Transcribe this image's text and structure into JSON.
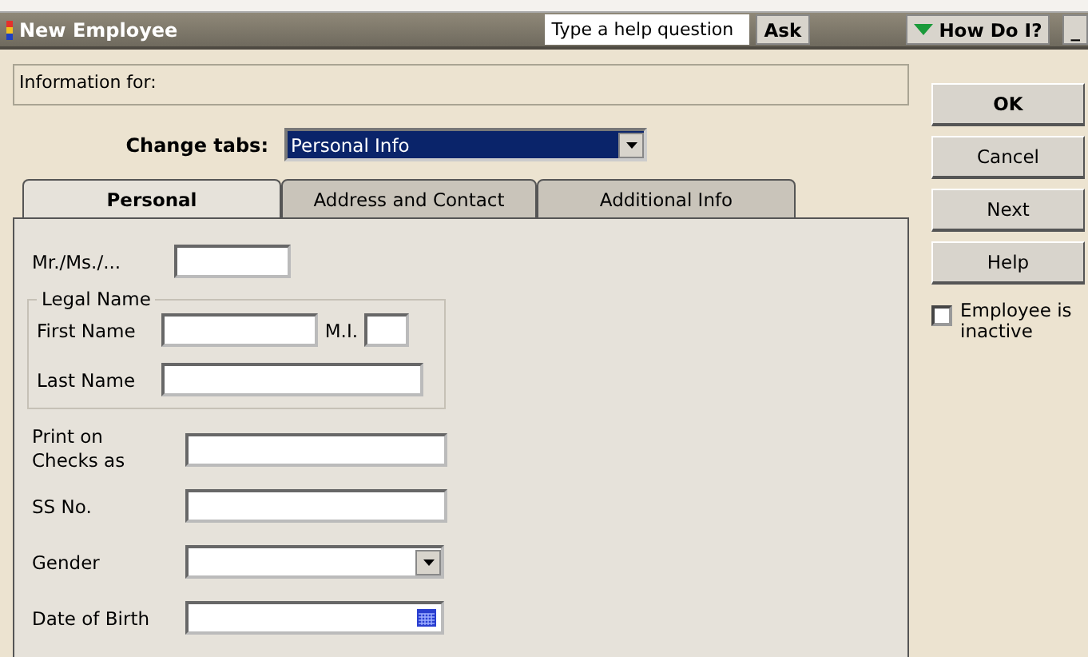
{
  "window": {
    "title": "New Employee"
  },
  "help": {
    "placeholder": "Type a help question",
    "ask": "Ask",
    "how_do_i": "How Do I?",
    "minimize": "_"
  },
  "info_for": {
    "label": "Information for:"
  },
  "change_tabs": {
    "label": "Change tabs:",
    "value": "Personal Info"
  },
  "tabs": [
    {
      "label": "Personal",
      "selected": true
    },
    {
      "label": "Address and Contact",
      "selected": false
    },
    {
      "label": "Additional Info",
      "selected": false
    }
  ],
  "form": {
    "salutation": "Mr./Ms./...",
    "legal_name": "Legal Name",
    "first_name": "First Name",
    "mi": "M.I.",
    "last_name": "Last Name",
    "print_on_checks": "Print on Checks as",
    "ss_no": "SS No.",
    "gender": "Gender",
    "dob": "Date of Birth"
  },
  "buttons": [
    {
      "label": "OK",
      "kind": "default"
    },
    {
      "label": "Cancel",
      "kind": "normal"
    },
    {
      "label": "Next",
      "kind": "normal"
    },
    {
      "label": "Help",
      "kind": "normal"
    }
  ],
  "inactive": {
    "label": "Employee is inactive",
    "checked": false
  }
}
